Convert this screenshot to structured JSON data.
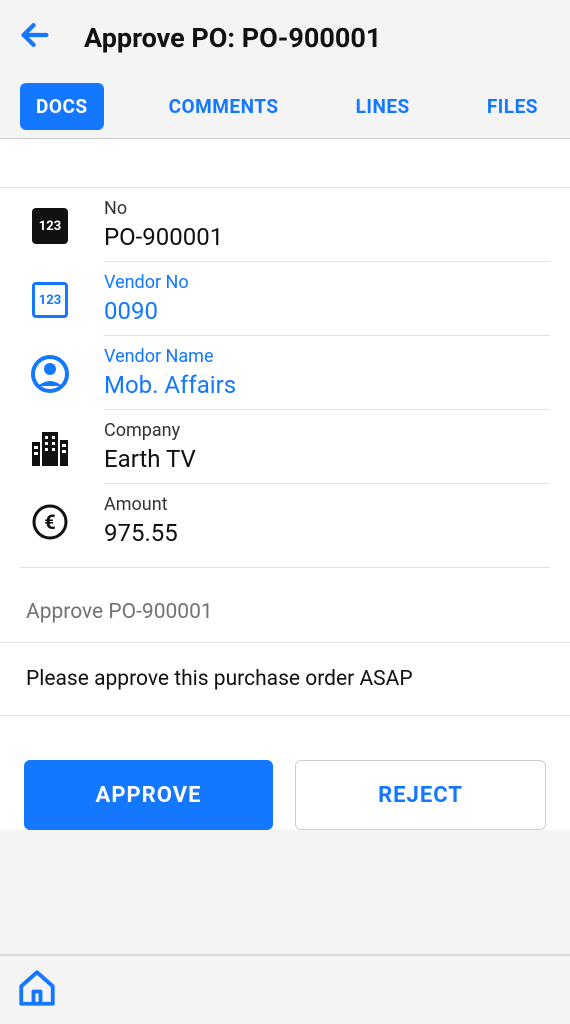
{
  "header": {
    "title": "Approve PO: PO-900001"
  },
  "tabs": {
    "docs": "DOCS",
    "comments": "COMMENTS",
    "lines": "LINES",
    "files": "FILES",
    "active": "docs"
  },
  "fields": {
    "no": {
      "label": "No",
      "value": "PO-900001",
      "icon_text": "123"
    },
    "vendor_no": {
      "label": "Vendor No",
      "value": "0090",
      "icon_text": "123"
    },
    "vendor_name": {
      "label": "Vendor Name",
      "value": "Mob. Affairs"
    },
    "company": {
      "label": "Company",
      "value": "Earth TV"
    },
    "amount": {
      "label": "Amount",
      "value": "975.55"
    }
  },
  "section_heading": "Approve PO-900001",
  "message": "Please approve this purchase order ASAP",
  "buttons": {
    "approve": "APPROVE",
    "reject": "REJECT"
  }
}
